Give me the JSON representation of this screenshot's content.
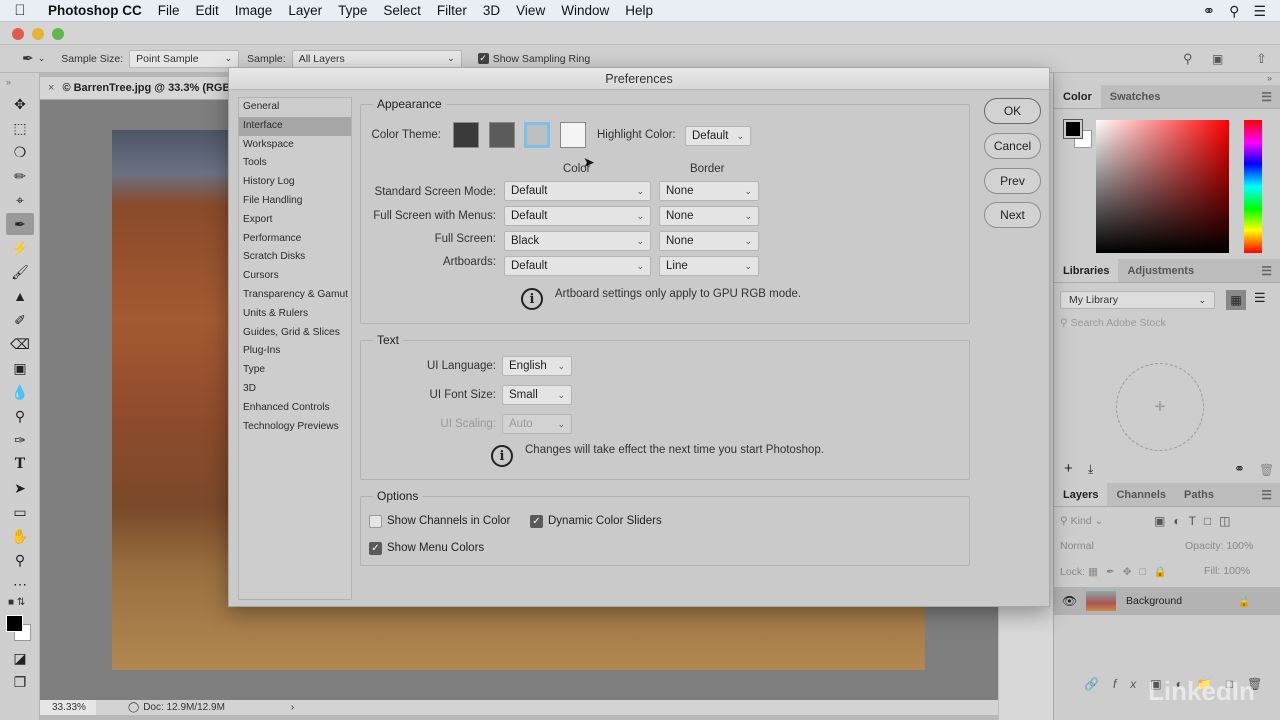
{
  "menubar": {
    "app": "Photoshop CC",
    "items": [
      "File",
      "Edit",
      "Image",
      "Layer",
      "Type",
      "Select",
      "Filter",
      "3D",
      "View",
      "Window",
      "Help"
    ]
  },
  "options_bar": {
    "sample_size_label": "Sample Size:",
    "sample_size_value": "Point Sample",
    "sample_label": "Sample:",
    "sample_value": "All Layers",
    "show_sampling_ring_label": "Show Sampling Ring",
    "show_sampling_ring_checked": true
  },
  "document": {
    "tab_title": "© BarrenTree.jpg @ 33.3% (RGB",
    "zoom": "33.33%",
    "doc_info": "Doc: 12.9M/12.9M"
  },
  "tools": [
    "move",
    "marquee",
    "lasso",
    "quick-selection",
    "crop",
    "eyedropper",
    "healing",
    "brush",
    "clone-stamp",
    "history-brush",
    "eraser",
    "gradient",
    "blur",
    "dodge",
    "pen",
    "type",
    "path-selection",
    "rectangle",
    "hand",
    "zoom",
    "more"
  ],
  "active_tool": "eyedropper",
  "dialog": {
    "title": "Preferences",
    "nav": [
      "General",
      "Interface",
      "Workspace",
      "Tools",
      "History Log",
      "File Handling",
      "Export",
      "Performance",
      "Scratch Disks",
      "Cursors",
      "Transparency & Gamut",
      "Units & Rulers",
      "Guides, Grid & Slices",
      "Plug-Ins",
      "Type",
      "3D",
      "Enhanced Controls",
      "Technology Previews"
    ],
    "active_nav": "Interface",
    "buttons": {
      "ok": "OK",
      "cancel": "Cancel",
      "prev": "Prev",
      "next": "Next"
    },
    "appearance": {
      "legend": "Appearance",
      "color_theme_label": "Color Theme:",
      "themes": [
        "#3a3a3a",
        "#5b5b5b",
        "#bfbfbf",
        "#f4f4f4"
      ],
      "selected_theme_index": 2,
      "highlight_label": "Highlight Color:",
      "highlight_value": "Default",
      "col_color": "Color",
      "col_border": "Border",
      "rows": [
        {
          "label": "Standard Screen Mode:",
          "color": "Default",
          "border": "None"
        },
        {
          "label": "Full Screen with Menus:",
          "color": "Default",
          "border": "None"
        },
        {
          "label": "Full Screen:",
          "color": "Black",
          "border": "None"
        },
        {
          "label": "Artboards:",
          "color": "Default",
          "border": "Line"
        }
      ],
      "note": "Artboard settings only apply to GPU RGB mode."
    },
    "text": {
      "legend": "Text",
      "ui_language_label": "UI Language:",
      "ui_language_value": "English",
      "ui_font_size_label": "UI Font Size:",
      "ui_font_size_value": "Small",
      "ui_scaling_label": "UI Scaling:",
      "ui_scaling_value": "Auto",
      "note": "Changes will take effect the next time you start Photoshop."
    },
    "options": {
      "legend": "Options",
      "show_channels_in_color": {
        "label": "Show Channels in Color",
        "checked": false
      },
      "dynamic_color_sliders": {
        "label": "Dynamic Color Sliders",
        "checked": true
      },
      "show_menu_colors": {
        "label": "Show Menu Colors",
        "checked": true
      }
    }
  },
  "panels": {
    "color_tabs": [
      "Color",
      "Swatches"
    ],
    "library_tabs": [
      "Libraries",
      "Adjustments"
    ],
    "library_value": "My Library",
    "search_placeholder": "Search Adobe Stock",
    "layers_tabs": [
      "Layers",
      "Channels",
      "Paths"
    ],
    "kind_label": "Kind",
    "blend_mode": "Normal",
    "opacity_label": "Opacity:",
    "opacity_value": "100%",
    "lock_label": "Lock:",
    "fill_label": "Fill:",
    "fill_value": "100%",
    "layer_name": "Background"
  },
  "watermark": {
    "brand": "LinkedIn"
  }
}
